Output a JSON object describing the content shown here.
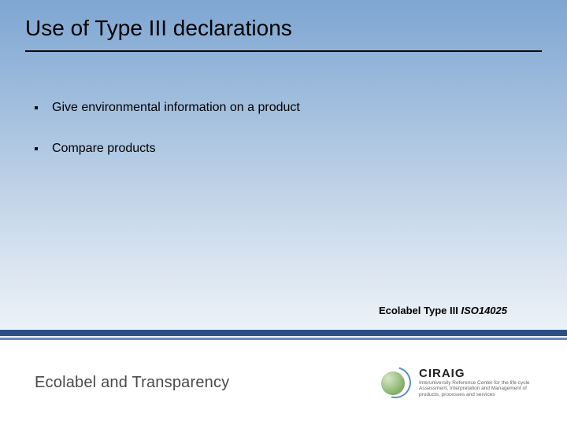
{
  "slide": {
    "title": "Use of Type III declarations",
    "bullets": [
      "Give environmental information on a product",
      "Compare products"
    ],
    "bottom_label_prefix": "Ecolabel Type III ",
    "bottom_label_iso": "ISO14025"
  },
  "footer": {
    "title": "Ecolabel and Transparency",
    "logo_name": "CIRAIG",
    "logo_tagline": "Interuniversity Reference Center for the life cycle Assessment, Interpretation and Management of products, processes and services"
  }
}
